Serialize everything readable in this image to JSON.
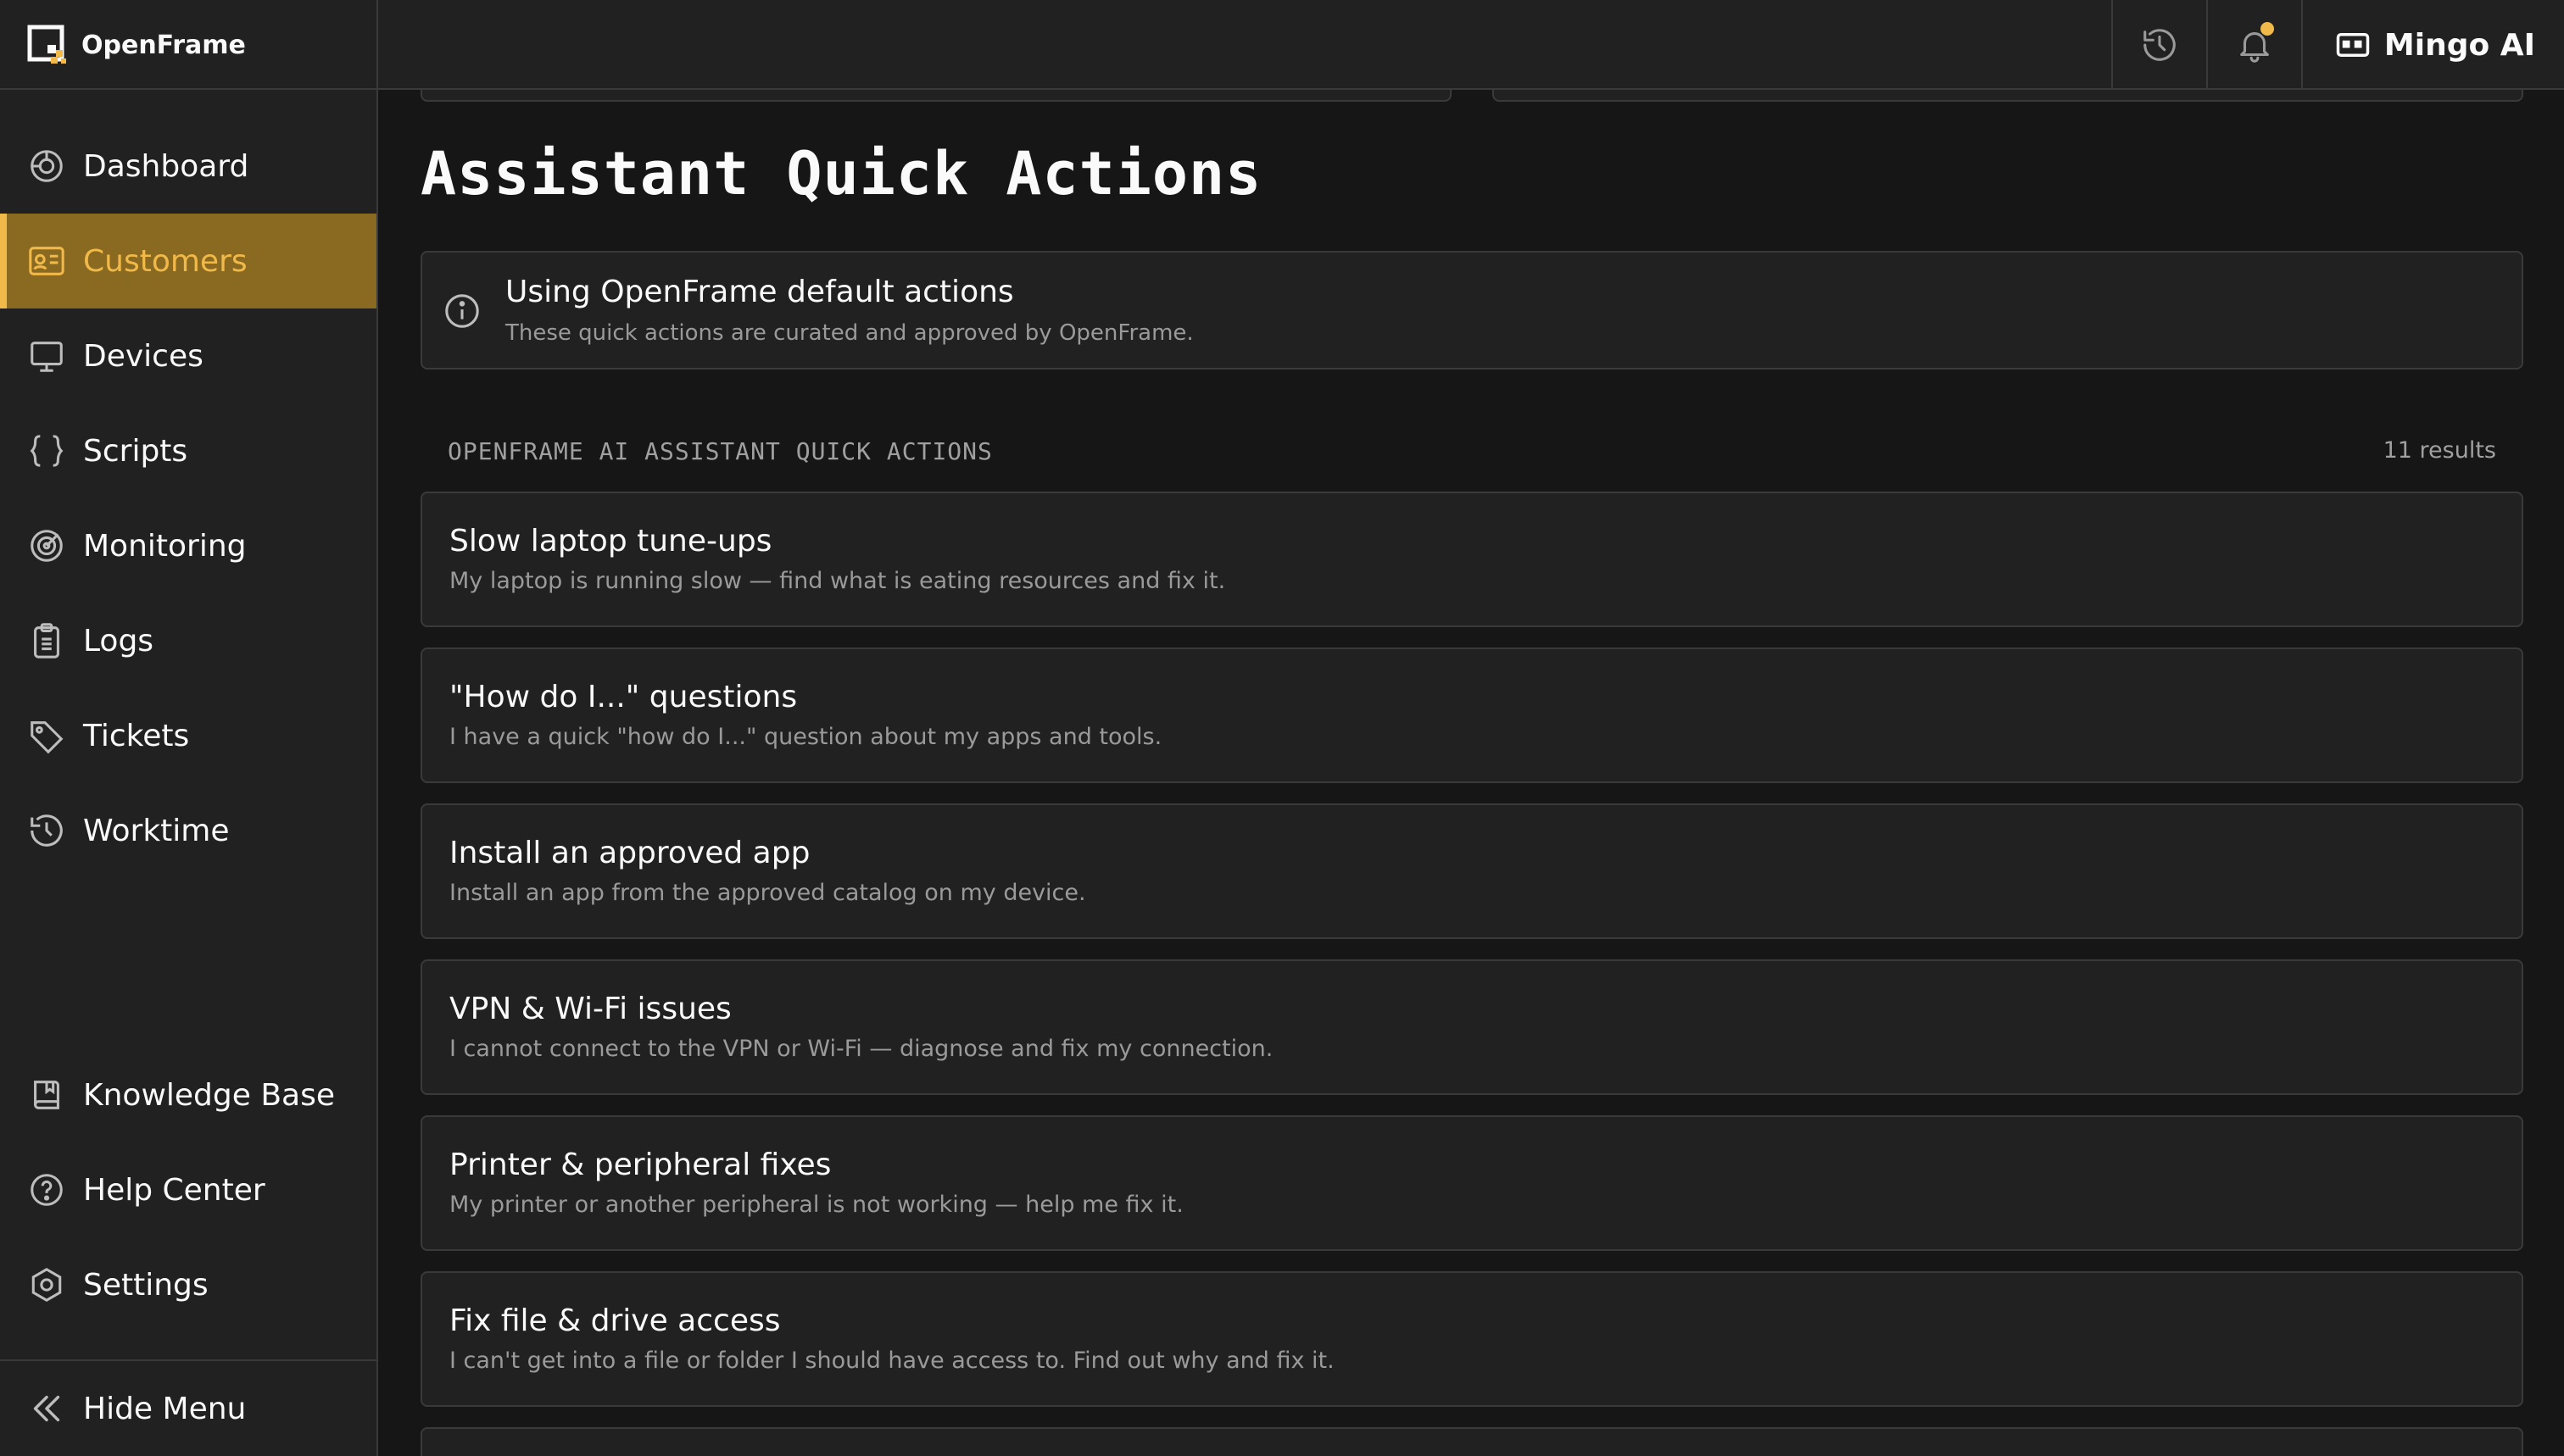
{
  "app": {
    "name": "OpenFrame"
  },
  "topbar": {
    "assistant_label": "Mingo AI"
  },
  "sidebar": {
    "items": [
      {
        "label": "Dashboard",
        "icon": "dashboard-icon"
      },
      {
        "label": "Customers",
        "icon": "customers-icon",
        "active": true
      },
      {
        "label": "Devices",
        "icon": "monitor-icon"
      },
      {
        "label": "Scripts",
        "icon": "braces-icon"
      },
      {
        "label": "Monitoring",
        "icon": "target-icon"
      },
      {
        "label": "Logs",
        "icon": "clipboard-icon"
      },
      {
        "label": "Tickets",
        "icon": "tag-icon"
      },
      {
        "label": "Worktime",
        "icon": "history-icon"
      }
    ],
    "bottom_items": [
      {
        "label": "Knowledge Base",
        "icon": "book-icon"
      },
      {
        "label": "Help Center",
        "icon": "help-icon"
      },
      {
        "label": "Settings",
        "icon": "settings-icon"
      }
    ],
    "hide_menu": "Hide Menu"
  },
  "main": {
    "title": "Assistant Quick Actions",
    "info": {
      "title": "Using OpenFrame default actions",
      "subtitle": "These quick actions are curated and approved by OpenFrame."
    },
    "section_title": "OPENFRAME AI ASSISTANT QUICK ACTIONS",
    "results": "11 results",
    "actions": [
      {
        "title": "Slow laptop tune-ups",
        "subtitle": "My laptop is running slow — find what is eating resources and fix it."
      },
      {
        "title": "\"How do I...\" questions",
        "subtitle": "I have a quick \"how do I...\" question about my apps and tools."
      },
      {
        "title": "Install an approved app",
        "subtitle": "Install an app from the approved catalog on my device."
      },
      {
        "title": "VPN & Wi-Fi issues",
        "subtitle": "I cannot connect to the VPN or Wi-Fi — diagnose and fix my connection."
      },
      {
        "title": "Printer & peripheral fixes",
        "subtitle": "My printer or another peripheral is not working — help me fix it."
      },
      {
        "title": "Fix file & drive access",
        "subtitle": "I can't get into a file or folder I should have access to. Find out why and fix it."
      }
    ]
  },
  "colors": {
    "accent": "#f0b94a",
    "active_bg": "#8a6a20",
    "surface": "#212121",
    "background": "#161616",
    "border": "#3a3a3a"
  }
}
